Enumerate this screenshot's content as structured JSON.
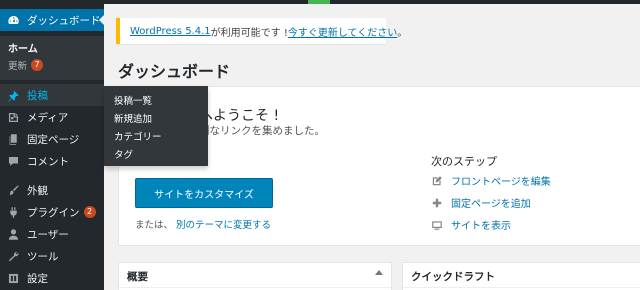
{
  "notice": {
    "link_version": "WordPress 5.4.1",
    "middle_text": " が利用可能です ! ",
    "link_update": "今すぐ更新してください",
    "end_text": "。"
  },
  "page": {
    "title": "ダッシュボード"
  },
  "sidebar": {
    "dashboard": {
      "label": "ダッシュボード",
      "icon": "dashboard-icon"
    },
    "home": "ホーム",
    "updates": {
      "label": "更新",
      "count": "7"
    },
    "posts": {
      "label": "投稿",
      "icon": "pin-icon"
    },
    "media": {
      "label": "メディア",
      "icon": "media-icon"
    },
    "pages": {
      "label": "固定ページ",
      "icon": "page-icon"
    },
    "comments": {
      "label": "コメント",
      "icon": "comment-icon"
    },
    "appearance": {
      "label": "外観",
      "icon": "brush-icon"
    },
    "plugins": {
      "label": "プラグイン",
      "count": "2",
      "icon": "plugin-icon"
    },
    "users": {
      "label": "ユーザー",
      "icon": "user-icon"
    },
    "tools": {
      "label": "ツール",
      "icon": "wrench-icon"
    },
    "settings": {
      "label": "設定",
      "icon": "settings-icon"
    }
  },
  "flyout": {
    "items": [
      "投稿一覧",
      "新規追加",
      "カテゴリー",
      "タグ"
    ]
  },
  "welcome": {
    "heading": "へようこそ !",
    "about": "利なリンクを集めました。",
    "customize_button": "サイトをカスタマイズ",
    "or_text": "または、",
    "theme_link": "別のテーマに変更する",
    "next_steps_title": "次のステップ",
    "steps": [
      {
        "label": "フロントページを編集",
        "icon": "edit-icon"
      },
      {
        "label": "固定ページを追加",
        "icon": "plus-icon"
      },
      {
        "label": "サイトを表示",
        "icon": "view-icon"
      }
    ]
  },
  "widgets": {
    "overview": "概要",
    "quick_draft": "クイックドラフト"
  },
  "colors": {
    "sidebar_bg": "#23282d",
    "accent": "#0073aa",
    "button": "#0085ba",
    "notice_border": "#ffb900",
    "badge": "#ca4a1f"
  }
}
